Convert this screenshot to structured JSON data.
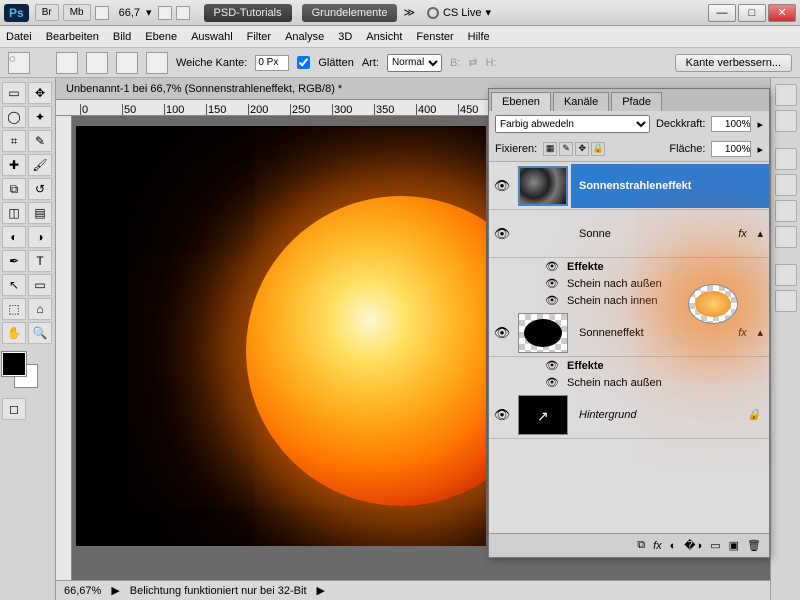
{
  "titlebar": {
    "zoom": "66,7",
    "tab1": "PSD-Tutorials",
    "tab2": "Grundelemente",
    "cslive": "CS Live"
  },
  "menu": [
    "Datei",
    "Bearbeiten",
    "Bild",
    "Ebene",
    "Auswahl",
    "Filter",
    "Analyse",
    "3D",
    "Ansicht",
    "Fenster",
    "Hilfe"
  ],
  "options": {
    "feather_label": "Weiche Kante:",
    "feather_value": "0 Px",
    "antialias_label": "Glätten",
    "style_label": "Art:",
    "style_value": "Normal",
    "width_label": "B:",
    "height_label": "H:",
    "refine": "Kante verbessern..."
  },
  "doc": {
    "tab": "Unbenannt-1 bei 66,7% (Sonnenstrahleneffekt, RGB/8) *"
  },
  "ruler_ticks": [
    "0",
    "50",
    "100",
    "150",
    "200",
    "250",
    "300",
    "350",
    "400",
    "450"
  ],
  "status": {
    "zoom": "66,67%",
    "msg": "Belichtung funktioniert nur bei 32-Bit"
  },
  "panel": {
    "tabs": [
      "Ebenen",
      "Kanäle",
      "Pfade"
    ],
    "blend": "Farbig abwedeln",
    "opacity_label": "Deckkraft:",
    "opacity": "100%",
    "lock_label": "Fixieren:",
    "fill_label": "Fläche:",
    "fill": "100%",
    "layers": [
      {
        "name": "Sonnenstrahleneffekt",
        "fx": false,
        "selected": true
      },
      {
        "name": "Sonne",
        "fx": true,
        "effects": [
          "Schein nach außen",
          "Schein nach innen"
        ]
      },
      {
        "name": "Sonneneffekt",
        "fx": true,
        "effects": [
          "Schein nach außen"
        ]
      },
      {
        "name": "Hintergrund",
        "fx": false,
        "locked": true,
        "italic": true
      }
    ],
    "fx_label": "Effekte",
    "fx_badge": "fx"
  }
}
